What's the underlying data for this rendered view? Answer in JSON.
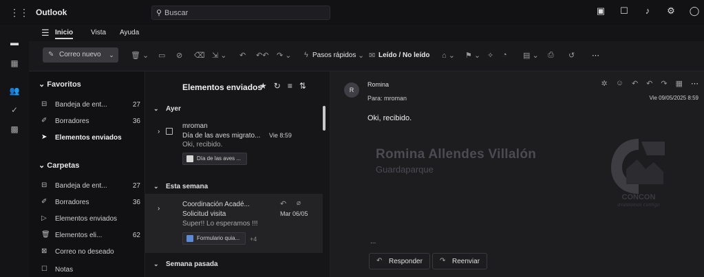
{
  "app": {
    "title": "Outlook"
  },
  "search": {
    "icon": "search-icon",
    "placeholder": "Buscar"
  },
  "top_icons": [
    "teams-icon",
    "feedback-icon",
    "bell-icon",
    "settings-icon"
  ],
  "rail": {
    "icons": [
      "mail-icon",
      "calendar-icon",
      "people-icon",
      "todo-icon",
      "apps-icon"
    ]
  },
  "menu": {
    "tabs": [
      "Inicio",
      "Vista",
      "Ayuda"
    ],
    "active": "Inicio"
  },
  "ribbon": {
    "new_mail": "Correo nuevo",
    "quick_steps": "Pasos rápidos",
    "read_unread": "Leído / No leído"
  },
  "folders": {
    "favorites_header": "Favoritos",
    "favorites": [
      {
        "label": "Bandeja de ent...",
        "count": "27",
        "icon": "inbox-icon"
      },
      {
        "label": "Borradores",
        "count": "36",
        "icon": "drafts-icon"
      },
      {
        "label": "Elementos enviados",
        "count": "",
        "icon": "sent-icon",
        "selected": true
      }
    ],
    "folders_header": "Carpetas",
    "folders": [
      {
        "label": "Bandeja de ent...",
        "count": "27",
        "icon": "inbox-icon"
      },
      {
        "label": "Borradores",
        "count": "36",
        "icon": "drafts-icon"
      },
      {
        "label": "Elementos enviados",
        "count": "",
        "icon": "sent-icon"
      },
      {
        "label": "Elementos eli...",
        "count": "62",
        "icon": "trash-icon"
      },
      {
        "label": "Correo no deseado",
        "count": "",
        "icon": "junk-icon"
      },
      {
        "label": "Notas",
        "count": "",
        "icon": "notes-icon"
      }
    ]
  },
  "list": {
    "title": "Elementos enviados",
    "groups": [
      {
        "label": "Ayer",
        "mail": {
          "sender": "mroman",
          "subject": "Día de las aves migrato...",
          "time": "Vie 8:59",
          "preview": "Oki, recibido.",
          "attachment": "Día de las aves ..."
        }
      },
      {
        "label": "Esta semana",
        "mail": {
          "sender": "Coordinación Acadé...",
          "subject": "Solicitud visita",
          "time": "Mar 06/05",
          "preview": "Super!! Lo esperamos !!!",
          "attachment": "Formulario quia...",
          "extra": "+4"
        }
      },
      {
        "label": "Semana pasada"
      }
    ]
  },
  "reading": {
    "avatar_initial": "R",
    "from": "Romina",
    "to": "Para: mroman",
    "date": "Vie 09/05/2025 8:59",
    "body": "Oki, recibido.",
    "signature_name": "Romina Allendes Villalón",
    "signature_role": "Guardaparque",
    "logo_text": "CONCON",
    "logo_tagline": "avanzamos contigo",
    "ellipsis": "...",
    "reply": "Responder",
    "forward": "Reenviar"
  }
}
